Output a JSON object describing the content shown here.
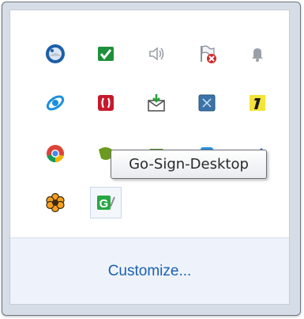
{
  "tray": {
    "icons": [
      {
        "name": "thunderbird-icon"
      },
      {
        "name": "go-sign-check-icon"
      },
      {
        "name": "volume-icon"
      },
      {
        "name": "action-center-flag-icon"
      },
      {
        "name": "notification-bell-icon"
      },
      {
        "name": "blue-swirl-icon"
      },
      {
        "name": "red-app-icon"
      },
      {
        "name": "mail-download-icon"
      },
      {
        "name": "blue-square-icon"
      },
      {
        "name": "number-one-icon"
      },
      {
        "name": "chrome-icon"
      },
      {
        "name": "green-app-icon"
      },
      {
        "name": "green-folder-icon"
      },
      {
        "name": "blue-app-icon"
      },
      {
        "name": "blue-pen-icon"
      },
      {
        "name": "orange-flower-icon"
      },
      {
        "name": "go-sign-desktop-icon"
      }
    ],
    "tooltip": "Go-Sign-Desktop",
    "customize_label": "Customize..."
  }
}
